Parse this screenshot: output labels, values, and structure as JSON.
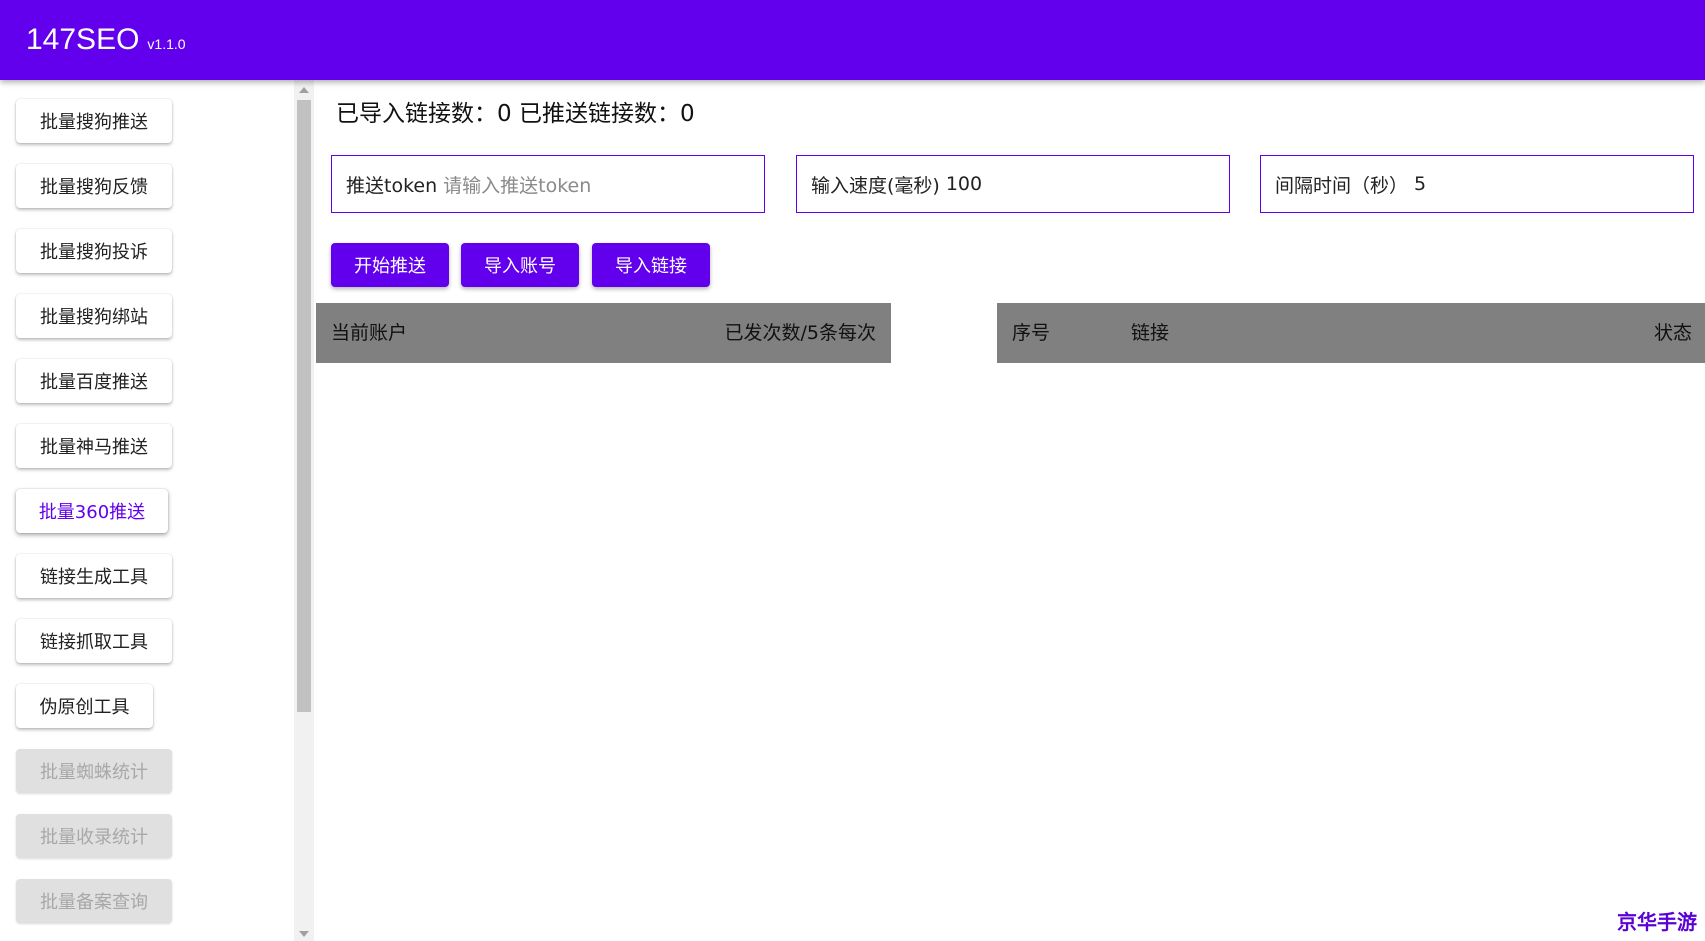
{
  "header": {
    "title": "147SEO",
    "version": "v1.1.0"
  },
  "sidebar": {
    "items": [
      {
        "label": "批量搜狗推送"
      },
      {
        "label": "批量搜狗反馈"
      },
      {
        "label": "批量搜狗投诉"
      },
      {
        "label": "批量搜狗绑站"
      },
      {
        "label": "批量百度推送"
      },
      {
        "label": "批量神马推送"
      },
      {
        "label": "批量360推送",
        "active": true
      },
      {
        "label": "链接生成工具"
      },
      {
        "label": "链接抓取工具"
      },
      {
        "label": "伪原创工具"
      },
      {
        "label": "批量蜘蛛统计",
        "disabled": true
      },
      {
        "label": "批量收录统计",
        "disabled": true
      },
      {
        "label": "批量备案查询",
        "disabled": true
      }
    ]
  },
  "stats": {
    "text": "已导入链接数：0 已推送链接数：0"
  },
  "fields": {
    "token_label": "推送token",
    "token_placeholder": "请输入推送token",
    "speed_label": "输入速度(毫秒)",
    "speed_value": "100",
    "interval_label": "间隔时间（秒）",
    "interval_value": "5"
  },
  "buttons": {
    "start": "开始推送",
    "import_accounts": "导入账号",
    "import_links": "导入链接"
  },
  "account_table": {
    "col_account": "当前账户",
    "col_sent": "已发次数/5条每次"
  },
  "link_table": {
    "col_index": "序号",
    "col_link": "链接",
    "col_status": "状态"
  },
  "watermark": "京华手游",
  "colors": {
    "primary": "#6200ee",
    "table_header": "#808080"
  }
}
